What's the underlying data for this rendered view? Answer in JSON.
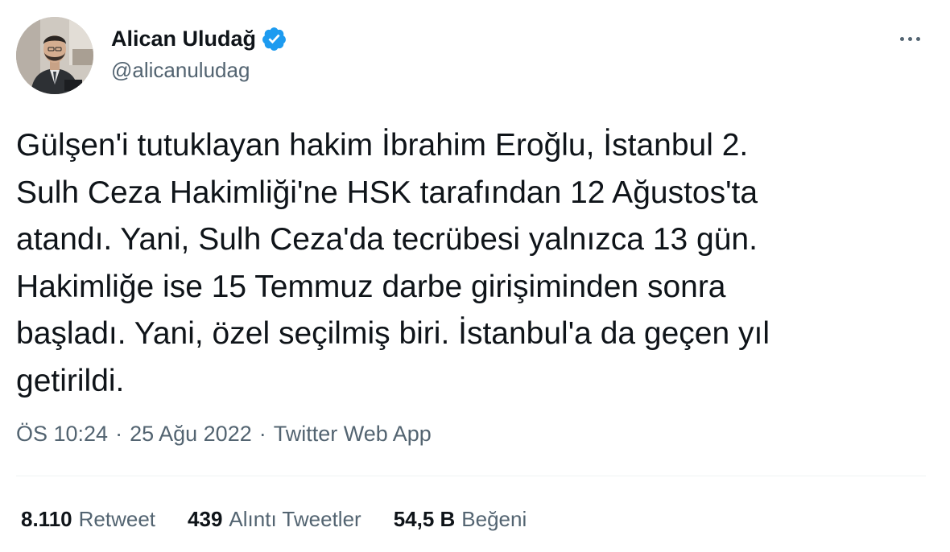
{
  "author": {
    "display_name": "Alican Uludağ",
    "handle": "@alicanuludag",
    "verified": true,
    "verified_color": "#1d9bf0"
  },
  "tweet": {
    "lines": [
      "Gülşen'i tutuklayan hakim İbrahim Eroğlu, İstanbul 2.",
      "Sulh Ceza Hakimliği'ne HSK tarafından 12 Ağustos'ta",
      "atandı. Yani, Sulh Ceza'da tecrübesi yalnızca 13 gün.",
      "Hakimliğe ise 15 Temmuz darbe girişiminden sonra",
      "başladı. Yani, özel seçilmiş biri. İstanbul'a da geçen yıl",
      "getirildi."
    ]
  },
  "meta": {
    "time": "ÖS 10:24",
    "date": "25 Ağu 2022",
    "separator": "·",
    "source": "Twitter Web App"
  },
  "stats": {
    "retweets": {
      "count": "8.110",
      "label": "Retweet"
    },
    "quotes": {
      "count": "439",
      "label": "Alıntı Tweetler"
    },
    "likes": {
      "count": "54,5 B",
      "label": "Beğeni"
    }
  },
  "icons": {
    "verified": "verified-badge-icon",
    "more": "more-horizontal-icon"
  },
  "colors": {
    "text_primary": "#0f1419",
    "text_secondary": "#536471",
    "divider": "#eff3f4"
  }
}
